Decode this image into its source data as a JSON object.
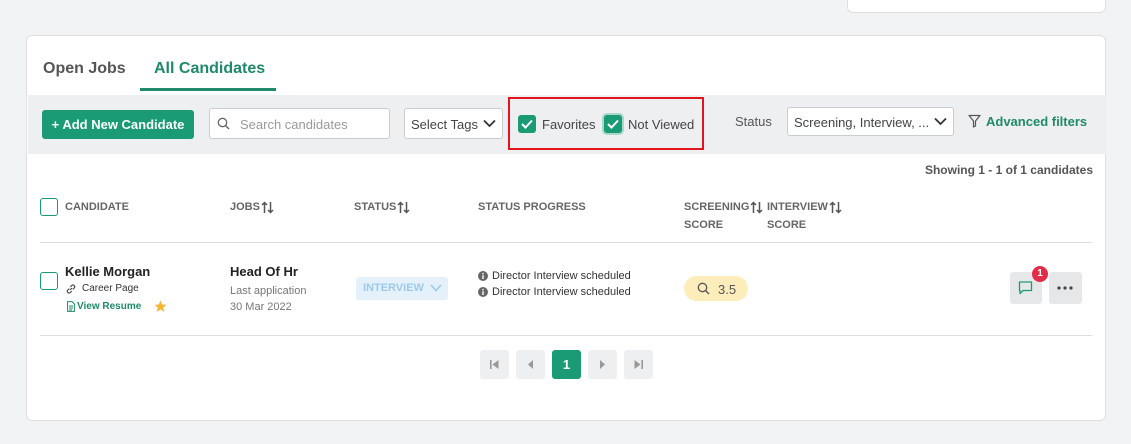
{
  "tabs": [
    {
      "label": "Open Jobs",
      "active": false
    },
    {
      "label": "All Candidates",
      "active": true
    }
  ],
  "toolbar": {
    "add_button_label": "+ Add New Candidate",
    "search_placeholder": "Search candidates",
    "tags_label": "Select Tags",
    "favorites": {
      "label": "Favorites",
      "checked": true
    },
    "not_viewed": {
      "label": "Not Viewed",
      "checked": true
    },
    "status_label": "Status",
    "status_value": "Screening, Interview, ...",
    "advanced_filters_label": "Advanced filters"
  },
  "showing_text": "Showing 1 - 1 of 1 candidates",
  "table": {
    "columns": {
      "candidate": "CANDIDATE",
      "jobs": "JOBS",
      "status": "STATUS",
      "status_progress": "STATUS PROGRESS",
      "screening_line1": "SCREENING",
      "screening_line2": "SCORE",
      "interview_line1": "INTERVIEW",
      "interview_line2": "SCORE"
    },
    "rows": [
      {
        "name": "Kellie Morgan",
        "source": "Career Page",
        "resume_label": "View Resume",
        "favorite": true,
        "job": "Head Of Hr",
        "last_application_label": "Last application",
        "last_application_date": "30 Mar 2022",
        "status": "INTERVIEW",
        "progress": [
          "Director Interview scheduled",
          "Director Interview scheduled"
        ],
        "screening_score": "3.5",
        "message_count": "1"
      }
    ]
  },
  "pagination": {
    "current_page": "1"
  },
  "colors": {
    "accent": "#1a9b76",
    "highlight_box": "#e1161c",
    "badge": "#e32b4a",
    "score_bg": "#fdedbb"
  }
}
